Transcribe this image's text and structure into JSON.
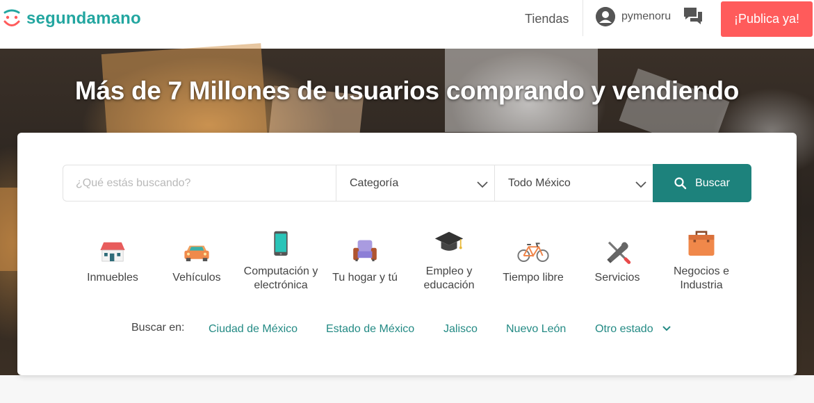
{
  "header": {
    "brand": "segundamano",
    "stores_label": "Tiendas",
    "username": "pymenoru",
    "publish_label": "¡Publica ya!"
  },
  "hero": {
    "title": "Más de 7 Millones de usuarios comprando y vendiendo"
  },
  "search": {
    "placeholder": "¿Qué estás buscando?",
    "category_value": "Categoría",
    "location_value": "Todo México",
    "button_label": "Buscar"
  },
  "categories": [
    {
      "label": "Inmuebles",
      "icon": "house-icon"
    },
    {
      "label": "Vehículos",
      "icon": "car-icon"
    },
    {
      "label": "Computación y electrónica",
      "icon": "phone-icon"
    },
    {
      "label": "Tu hogar y tú",
      "icon": "armchair-icon"
    },
    {
      "label": "Empleo y educación",
      "icon": "graduation-cap-icon"
    },
    {
      "label": "Tiempo libre",
      "icon": "bicycle-icon"
    },
    {
      "label": "Servicios",
      "icon": "tools-icon"
    },
    {
      "label": "Negocios e Industria",
      "icon": "briefcase-icon"
    }
  ],
  "regions": {
    "label": "Buscar en:",
    "items": [
      "Ciudad de México",
      "Estado de México",
      "Jalisco",
      "Nuevo León",
      "Otro estado"
    ]
  },
  "colors": {
    "brand_teal": "#23a6a0",
    "button_teal": "#1d827c",
    "publish_red": "#ff5b5b",
    "link_teal": "#238a84"
  }
}
